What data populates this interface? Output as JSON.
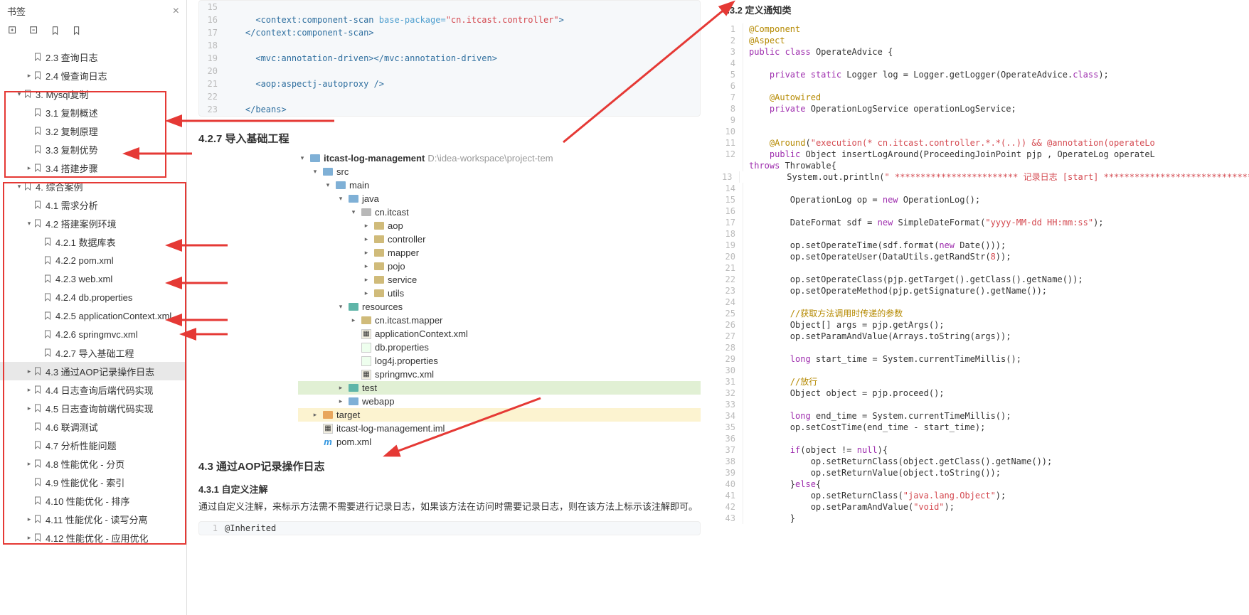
{
  "sidebar": {
    "title": "书签",
    "items": [
      {
        "depth": 2,
        "caret": "",
        "label": "2.3 查询日志"
      },
      {
        "depth": 2,
        "caret": "▸",
        "label": "2.4 慢查询日志"
      },
      {
        "depth": 1,
        "caret": "▾",
        "label": "3. Mysql复制"
      },
      {
        "depth": 2,
        "caret": "",
        "label": "3.1 复制概述"
      },
      {
        "depth": 2,
        "caret": "",
        "label": "3.2 复制原理"
      },
      {
        "depth": 2,
        "caret": "",
        "label": "3.3 复制优势"
      },
      {
        "depth": 2,
        "caret": "▸",
        "label": "3.4 搭建步骤"
      },
      {
        "depth": 1,
        "caret": "▾",
        "label": "4. 综合案例"
      },
      {
        "depth": 2,
        "caret": "",
        "label": "4.1 需求分析"
      },
      {
        "depth": 2,
        "caret": "▾",
        "label": "4.2 搭建案例环境"
      },
      {
        "depth": 3,
        "caret": "",
        "label": "4.2.1 数据库表"
      },
      {
        "depth": 3,
        "caret": "",
        "label": "4.2.2 pom.xml"
      },
      {
        "depth": 3,
        "caret": "",
        "label": "4.2.3 web.xml"
      },
      {
        "depth": 3,
        "caret": "",
        "label": "4.2.4 db.properties"
      },
      {
        "depth": 3,
        "caret": "",
        "label": "4.2.5 applicationContext.xml"
      },
      {
        "depth": 3,
        "caret": "",
        "label": "4.2.6 springmvc.xml"
      },
      {
        "depth": 3,
        "caret": "",
        "label": "4.2.7 导入基础工程"
      },
      {
        "depth": 2,
        "caret": "▸",
        "label": "4.3 通过AOP记录操作日志",
        "selected": true
      },
      {
        "depth": 2,
        "caret": "▸",
        "label": "4.4 日志查询后端代码实现"
      },
      {
        "depth": 2,
        "caret": "▸",
        "label": "4.5 日志查询前端代码实现"
      },
      {
        "depth": 2,
        "caret": "",
        "label": "4.6 联调测试"
      },
      {
        "depth": 2,
        "caret": "",
        "label": "4.7 分析性能问题"
      },
      {
        "depth": 2,
        "caret": "▸",
        "label": "4.8 性能优化 - 分页"
      },
      {
        "depth": 2,
        "caret": "",
        "label": "4.9 性能优化 - 索引"
      },
      {
        "depth": 2,
        "caret": "",
        "label": "4.10 性能优化 - 排序"
      },
      {
        "depth": 2,
        "caret": "▸",
        "label": "4.11 性能优化 - 读写分离"
      },
      {
        "depth": 2,
        "caret": "▸",
        "label": "4.12 性能优化 - 应用优化"
      }
    ]
  },
  "middle": {
    "code_top": [
      {
        "n": 15,
        "html": "",
        "indent": 4
      },
      {
        "n": 16,
        "html": "<span class='tag'>&lt;context:component-scan</span> <span class='attr'>base-package=</span><span class='str'>\"cn.itcast.controller\"</span><span class='tag'>&gt;</span>",
        "indent": 6
      },
      {
        "n": 17,
        "html": "<span class='tag'>&lt;/context:component-scan&gt;</span>",
        "indent": 4
      },
      {
        "n": 18,
        "html": "",
        "indent": 4
      },
      {
        "n": 19,
        "html": "<span class='tag'>&lt;mvc:annotation-driven&gt;&lt;/mvc:annotation-driven&gt;</span>",
        "indent": 6
      },
      {
        "n": 20,
        "html": "",
        "indent": 4
      },
      {
        "n": 21,
        "html": "<span class='tag'>&lt;aop:aspectj-autoproxy /&gt;</span>",
        "indent": 6
      },
      {
        "n": 22,
        "html": "",
        "indent": 4
      },
      {
        "n": 23,
        "html": "<span class='tag'>&lt;/beans&gt;</span>",
        "indent": 4
      }
    ],
    "h427": "4.2.7 导入基础工程",
    "tree_root": "itcast-log-management",
    "tree_root_path": "D:\\idea-workspace\\project-tem",
    "tree": [
      {
        "d": 1,
        "c": "▾",
        "ic": "folder blue",
        "t": "src"
      },
      {
        "d": 2,
        "c": "▾",
        "ic": "folder blue",
        "t": "main"
      },
      {
        "d": 3,
        "c": "▾",
        "ic": "folder blue",
        "t": "java"
      },
      {
        "d": 4,
        "c": "▾",
        "ic": "folder grey",
        "t": "cn.itcast"
      },
      {
        "d": 5,
        "c": "▸",
        "ic": "folder",
        "t": "aop"
      },
      {
        "d": 5,
        "c": "▸",
        "ic": "folder",
        "t": "controller"
      },
      {
        "d": 5,
        "c": "▸",
        "ic": "folder",
        "t": "mapper"
      },
      {
        "d": 5,
        "c": "▸",
        "ic": "folder",
        "t": "pojo"
      },
      {
        "d": 5,
        "c": "▸",
        "ic": "folder",
        "t": "service"
      },
      {
        "d": 5,
        "c": "▸",
        "ic": "folder",
        "t": "utils"
      },
      {
        "d": 3,
        "c": "▾",
        "ic": "folder teal",
        "t": "resources"
      },
      {
        "d": 4,
        "c": "▸",
        "ic": "folder",
        "t": "cn.itcast.mapper"
      },
      {
        "d": 4,
        "c": "",
        "ic": "xml",
        "t": "applicationContext.xml"
      },
      {
        "d": 4,
        "c": "",
        "ic": "prop",
        "t": "db.properties"
      },
      {
        "d": 4,
        "c": "",
        "ic": "prop",
        "t": "log4j.properties"
      },
      {
        "d": 4,
        "c": "",
        "ic": "xml",
        "t": "springmvc.xml"
      },
      {
        "d": 3,
        "c": "▸",
        "ic": "folder teal",
        "t": "test",
        "hl": "green"
      },
      {
        "d": 3,
        "c": "▸",
        "ic": "folder blue",
        "t": "webapp"
      },
      {
        "d": 1,
        "c": "▸",
        "ic": "folder orange",
        "t": "target",
        "hl": "yellow"
      },
      {
        "d": 1,
        "c": "",
        "ic": "xml",
        "t": "itcast-log-management.iml"
      },
      {
        "d": 1,
        "c": "",
        "ic": "m",
        "t": "pom.xml"
      }
    ],
    "h43": "4.3 通过AOP记录操作日志",
    "h431": "4.3.1 自定义注解",
    "p431": "通过自定义注解，来标示方法需不需要进行记录日志，如果该方法在访问时需要记录日志，则在该方法上标示该注解即可。",
    "inherited": "@Inherited"
  },
  "right": {
    "h432": "4.3.2 定义通知类",
    "lines": [
      {
        "n": 1,
        "h": "<span class='ann'>@Component</span>"
      },
      {
        "n": 2,
        "h": "<span class='ann'>@Aspect</span>"
      },
      {
        "n": 3,
        "h": "<span class='kw'>public</span> <span class='kw'>class</span> OperateAdvice {"
      },
      {
        "n": 4,
        "h": ""
      },
      {
        "n": 5,
        "h": "    <span class='kw'>private</span> <span class='kw'>static</span> Logger log = Logger.getLogger(OperateAdvice.<span class='kw'>class</span>);"
      },
      {
        "n": 6,
        "h": ""
      },
      {
        "n": 7,
        "h": "    <span class='ann'>@Autowired</span>"
      },
      {
        "n": 8,
        "h": "    <span class='kw'>private</span> OperationLogService operationLogService;"
      },
      {
        "n": 9,
        "h": ""
      },
      {
        "n": 10,
        "h": ""
      },
      {
        "n": 11,
        "h": "    <span class='ann'>@Around</span>(<span class='str2'>\"execution(* cn.itcast.controller.*.*(..)) && @annotation(operateLo</span>"
      },
      {
        "n": 12,
        "h": "    <span class='kw'>public</span> Object insertLogAround(ProceedingJoinPoint pjp , OperateLog operateL"
      },
      {
        "n": "",
        "h": "<span class='kw'>throws</span> Throwable{"
      },
      {
        "n": 13,
        "h": "        System.out.println(<span class='str2'>\" ************************ 记录日志 [start] ****************************** \"</span>);"
      },
      {
        "n": 14,
        "h": ""
      },
      {
        "n": 15,
        "h": "        OperationLog op = <span class='kw'>new</span> OperationLog();"
      },
      {
        "n": 16,
        "h": ""
      },
      {
        "n": 17,
        "h": "        DateFormat sdf = <span class='kw'>new</span> SimpleDateFormat(<span class='str2'>\"yyyy-MM-dd HH:mm:ss\"</span>);"
      },
      {
        "n": 18,
        "h": ""
      },
      {
        "n": 19,
        "h": "        op.setOperateTime(sdf.format(<span class='kw'>new</span> Date()));"
      },
      {
        "n": 20,
        "h": "        op.setOperateUser(DataUtils.getRandStr(<span class='str2'>8</span>));"
      },
      {
        "n": 21,
        "h": ""
      },
      {
        "n": 22,
        "h": "        op.setOperateClass(pjp.getTarget().getClass().getName());"
      },
      {
        "n": 23,
        "h": "        op.setOperateMethod(pjp.getSignature().getName());"
      },
      {
        "n": 24,
        "h": ""
      },
      {
        "n": 25,
        "h": "        <span class='cmt'>//获取方法调用时传递的参数</span>"
      },
      {
        "n": 26,
        "h": "        Object[] args = pjp.getArgs();"
      },
      {
        "n": 27,
        "h": "        op.setParamAndValue(Arrays.toString(args));"
      },
      {
        "n": 28,
        "h": ""
      },
      {
        "n": 29,
        "h": "        <span class='kw'>long</span> start_time = System.currentTimeMillis();"
      },
      {
        "n": 30,
        "h": ""
      },
      {
        "n": 31,
        "h": "        <span class='cmt'>//放行</span>"
      },
      {
        "n": 32,
        "h": "        Object object = pjp.proceed();"
      },
      {
        "n": 33,
        "h": ""
      },
      {
        "n": 34,
        "h": "        <span class='kw'>long</span> end_time = System.currentTimeMillis();"
      },
      {
        "n": 35,
        "h": "        op.setCostTime(end_time - start_time);"
      },
      {
        "n": 36,
        "h": ""
      },
      {
        "n": 37,
        "h": "        <span class='kw'>if</span>(object != <span class='kw'>null</span>){"
      },
      {
        "n": 38,
        "h": "            op.setReturnClass(object.getClass().getName());"
      },
      {
        "n": 39,
        "h": "            op.setReturnValue(object.toString());"
      },
      {
        "n": 40,
        "h": "        }<span class='kw'>else</span>{"
      },
      {
        "n": 41,
        "h": "            op.setReturnClass(<span class='str2'>\"java.lang.Object\"</span>);"
      },
      {
        "n": 42,
        "h": "            op.setParamAndValue(<span class='str2'>\"void\"</span>);"
      },
      {
        "n": 43,
        "h": "        }"
      }
    ]
  }
}
